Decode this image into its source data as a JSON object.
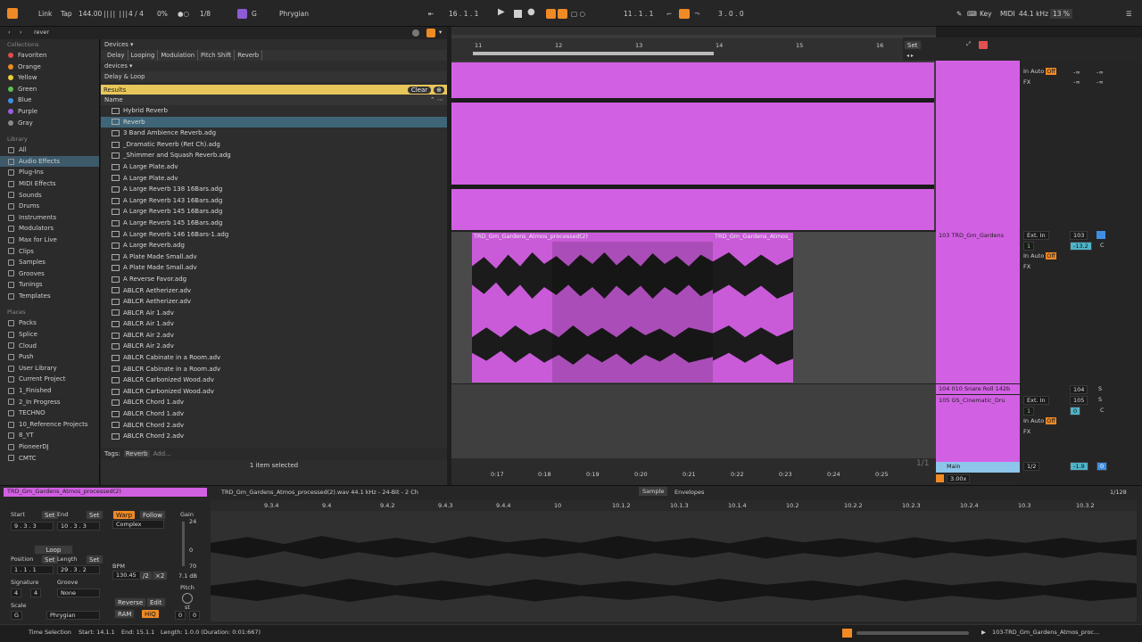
{
  "transport": {
    "link": "Link",
    "tap": "Tap",
    "tempo": "144.00",
    "signature": "4 / 4",
    "cpu_overload": "0%",
    "quantize": "1/8",
    "key_root": "G",
    "scale": "Phrygian",
    "arr_position": "16 .  1 .  1",
    "loop_start": "11 .  1 .  1",
    "loop_length": "3 .  0 .  0",
    "key_label": "Key",
    "midi_label": "MIDI",
    "sample_rate": "44.1 kHz",
    "cpu_meter": "13 %"
  },
  "browser": {
    "search_value": "rever",
    "collections_title": "Collections",
    "collections": [
      {
        "label": "Favoriten",
        "color": "#e14b4b"
      },
      {
        "label": "Orange",
        "color": "#f08a24"
      },
      {
        "label": "Yellow",
        "color": "#e6cf3a"
      },
      {
        "label": "Green",
        "color": "#5bc14f"
      },
      {
        "label": "Blue",
        "color": "#3f8ee6"
      },
      {
        "label": "Purple",
        "color": "#9b5ee0"
      },
      {
        "label": "Gray",
        "color": "#8a8a8a"
      }
    ],
    "library_title": "Library",
    "library": [
      "All",
      "Audio Effects",
      "Plug-Ins",
      "MIDI Effects",
      "Sounds",
      "Drums",
      "Instruments",
      "Modulators",
      "Max for Live",
      "Clips",
      "Samples",
      "Grooves",
      "Tunings",
      "Templates"
    ],
    "places_title": "Places",
    "places": [
      "Packs",
      "Splice",
      "Cloud",
      "Push",
      "User Library",
      "Current Project",
      "1_Finished",
      "2_In Progress",
      "TECHNO",
      "10_Reference Projects",
      "8_YT",
      "PioneerDJ",
      "CMTC"
    ],
    "filter_devices": "Devices ▾",
    "filter_tags": [
      "Delay",
      "Looping",
      "Modulation",
      "Pitch Shift",
      "Reverb"
    ],
    "filter_sub": "devices ▾",
    "filter_sub_tag": "Delay & Loop",
    "results_label": "Results",
    "clear_label": "Clear",
    "name_header": "Name",
    "results": [
      "Hybrid Reverb",
      "Reverb",
      "3 Band Ambience Reverb.adg",
      "_Dramatic Reverb (Ret Ch).adg",
      "_Shimmer and Squash Reverb.adg",
      "A Large Plate.adv",
      "A Large Plate.adv",
      "A Large Reverb 138 16Bars.adg",
      "A Large Reverb 143 16Bars.adg",
      "A Large Reverb 145 16Bars.adg",
      "A Large Reverb 145 16Bars.adg",
      "A Large Reverb 146 16Bars-1.adg",
      "A Large Reverb.adg",
      "A Plate Made Small.adv",
      "A Plate Made Small.adv",
      "A Reverse Favor.adg",
      "ABLCR Aetherizer.adv",
      "ABLCR Aetherizer.adv",
      "ABLCR Air 1.adv",
      "ABLCR Air 1.adv",
      "ABLCR Air 2.adv",
      "ABLCR Air 2.adv",
      "ABLCR Cabinate in a Room.adv",
      "ABLCR Cabinate in a Room.adv",
      "ABLCR Carbonized Wood.adv",
      "ABLCR Carbonized Wood.adv",
      "ABLCR Chord 1.adv",
      "ABLCR Chord 1.adv",
      "ABLCR Chord 2.adv",
      "ABLCR Chord 2.adv"
    ],
    "tags_label": "Tags:",
    "tag_value": "Reverb",
    "tag_add": "Add...",
    "selected_count": "1 item selected"
  },
  "arrangement": {
    "bars": [
      "11",
      "12",
      "13",
      "14",
      "15",
      "16"
    ],
    "set_label": "Set",
    "clip_a": "TRD_Gm_Gardens_Atmos_processed(2)",
    "clip_b": "TRD_Gm_Gardens_Atmos_",
    "time_ticks": [
      "0:17",
      "0:18",
      "0:19",
      "0:20",
      "0:21",
      "0:22",
      "0:23",
      "0:24",
      "0:25"
    ],
    "page": "1/1",
    "zoom": "3.00x"
  },
  "mixer": {
    "track_103": "103 TRD_Gm_Gardens",
    "track_104": "104 010 Snare Roll 142b",
    "track_105": "105 GS_Cinematic_Dru",
    "main": "Main",
    "ext_in": "Ext. In",
    "input_ch": "1",
    "in": "In",
    "auto": "Auto",
    "off": "Off",
    "fx": "FX",
    "neg_inf": "-∞",
    "vol_103": "103",
    "db_103": "-13.2",
    "pan": "C",
    "vol_104": "104",
    "vol_105": "105",
    "db_105": "0",
    "s": "S",
    "main_ratio": "1/2",
    "main_db": "-1.9",
    "main_val": "0"
  },
  "clip_detail": {
    "clip_name": "TRD_Gm_Gardens_Atmos_processed(2)",
    "file_info": "TRD_Gm_Gardens_Atmos_processed(2).wav  44.1 kHz - 24-Bit - 2 Ch",
    "tab_sample": "Sample",
    "tab_envelopes": "Envelopes",
    "grid": "1/128",
    "start_label": "Start",
    "end_label": "End",
    "set_label": "Set",
    "start_val": "9 .  3 .  3",
    "end_val": "10 .  3 .  3",
    "loop_label": "Loop",
    "position_label": "Position",
    "length_label": "Length",
    "position_val": "1 .  1 .  1",
    "length_val": "29 .  3 .  2",
    "signature_label": "Signature",
    "groove_label": "Groove",
    "sig_num": "4",
    "sig_den": "4",
    "groove_val": "None",
    "scale_label": "Scale",
    "scale_root": "G",
    "scale_name": "Phrygian",
    "warp_label": "Warp",
    "follow_label": "Follow",
    "warp_mode": "Complex",
    "bpm_label": "BPM",
    "bpm_val": "130.45",
    "half": "/2",
    "double": "×2",
    "reverse": "Reverse",
    "edit": "Edit",
    "ram": "RAM",
    "hiq": "HiQ",
    "gain_label": "Gain",
    "gain_db": "7.1 dB",
    "pitch_label": "Pitch",
    "pitch_unit": "st",
    "pitch_val": "0",
    "pitch_fine": "0",
    "gain_top": "24",
    "gain_mid": "0",
    "gain_bot": "70",
    "ruler": [
      "9.3.4",
      "9.4",
      "9.4.2",
      "9.4.3",
      "9.4.4",
      "10",
      "10.1.2",
      "10.1.3",
      "10.1.4",
      "10.2",
      "10.2.2",
      "10.2.3",
      "10.2.4",
      "10.3",
      "10.3.2"
    ]
  },
  "status": {
    "mode": "Time Selection",
    "start": "Start: 14.1.1",
    "end": "End: 15.1.1",
    "length": "Length: 1.0.0  (Duration: 0:01:667)",
    "track": "103-TRD_Gm_Gardens_Atmos_proc..."
  },
  "colors": {
    "accent": "#f08a24",
    "clip": "#d260e3",
    "selected": "#3e6678",
    "results_bar": "#e8c75a"
  }
}
